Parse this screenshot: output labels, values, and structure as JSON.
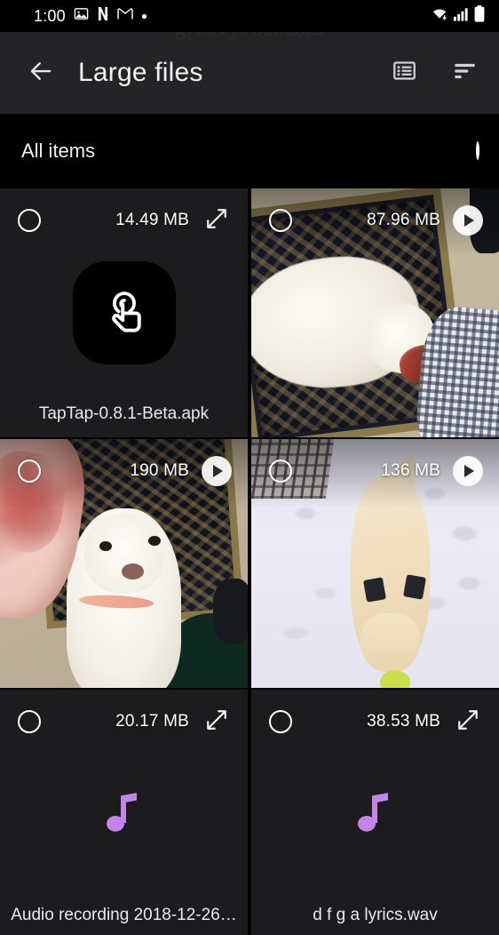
{
  "statusbar": {
    "time": "1:00",
    "icons_left": [
      "photos-icon",
      "netflix-icon",
      "gmail-icon",
      "dot-icon"
    ],
    "icons_right": [
      "wifi-icon",
      "cellular-signal-icon",
      "battery-icon"
    ]
  },
  "watermark": {
    "text": "groovyPost.com"
  },
  "appbar": {
    "back_icon": "back-arrow-icon",
    "title": "Large files",
    "actions": [
      {
        "name": "list-view-icon"
      },
      {
        "name": "sort-icon"
      }
    ]
  },
  "selection_bar": {
    "label": "All items",
    "checkbox": {
      "name": "select-all-radio",
      "checked": false
    }
  },
  "grid": {
    "items": [
      {
        "name": "TapTap-0.8.1-Beta.apk",
        "size": "14.49 MB",
        "type": "apk",
        "icon": "taptap-app-icon",
        "action_icon": "expand-icon",
        "selected": false,
        "show_name": true
      },
      {
        "name": "",
        "size": "87.96 MB",
        "type": "video",
        "thumbnail": "dog-lying-on-rug-with-bone",
        "action_icon": "play-icon",
        "selected": false,
        "show_name": false
      },
      {
        "name": "",
        "size": "190 MB",
        "type": "video",
        "thumbnail": "dog-looking-up-with-large-bone",
        "action_icon": "play-icon",
        "selected": false,
        "show_name": false
      },
      {
        "name": "",
        "size": "136 MB",
        "type": "video",
        "thumbnail": "dog-playing-in-snow",
        "action_icon": "play-icon",
        "selected": false,
        "show_name": false
      },
      {
        "name": "Audio recording 2018-12-26…",
        "size": "20.17 MB",
        "type": "audio",
        "icon": "music-note-icon",
        "action_icon": "expand-icon",
        "selected": false,
        "show_name": true
      },
      {
        "name": "d f g a lyrics.wav",
        "size": "38.53 MB",
        "type": "audio",
        "icon": "music-note-icon",
        "action_icon": "expand-icon",
        "selected": false,
        "show_name": true
      }
    ]
  },
  "colors": {
    "appbar_bg": "#242427",
    "page_bg": "#000000",
    "cell_bg": "#1c1c1f",
    "text_primary": "#f2f2f2",
    "music_note": "#c585e8",
    "watermark": "#2e2e2e"
  }
}
